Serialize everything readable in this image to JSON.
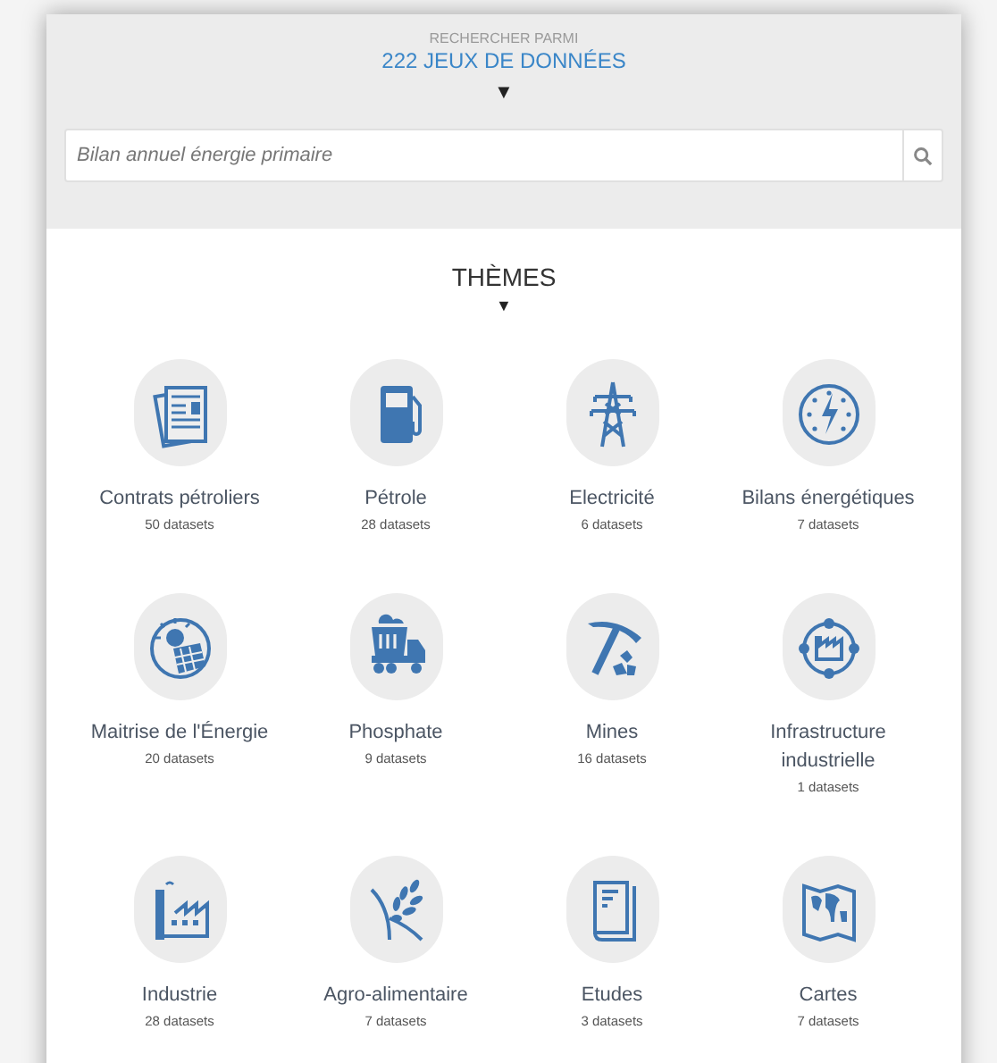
{
  "header": {
    "overline": "RECHERCHER PARMI",
    "title": "222 JEUX DE DONNÉES",
    "toggle": "▼"
  },
  "search": {
    "placeholder": "Bilan annuel énergie primaire"
  },
  "themes": {
    "title": "THÈMES",
    "toggle": "▼",
    "items": [
      {
        "kind": "contracts",
        "label": "Contrats pétroliers",
        "count": "50 datasets"
      },
      {
        "kind": "fuel",
        "label": "Pétrole",
        "count": "28 datasets"
      },
      {
        "kind": "pylon",
        "label": "Electricité",
        "count": "6 datasets"
      },
      {
        "kind": "gauge",
        "label": "Bilans énergétiques",
        "count": "7 datasets"
      },
      {
        "kind": "solar",
        "label": "Maitrise de l'Énergie",
        "count": "20 datasets"
      },
      {
        "kind": "truck",
        "label": "Phosphate",
        "count": "9 datasets"
      },
      {
        "kind": "pickaxe",
        "label": "Mines",
        "count": "16 datasets"
      },
      {
        "kind": "network",
        "label": "Infrastructure industrielle",
        "count": "1 datasets"
      },
      {
        "kind": "factory",
        "label": "Industrie",
        "count": "28 datasets"
      },
      {
        "kind": "wheat",
        "label": "Agro-alimentaire",
        "count": "7 datasets"
      },
      {
        "kind": "book",
        "label": "Etudes",
        "count": "3 datasets"
      },
      {
        "kind": "map",
        "label": "Cartes",
        "count": "7 datasets"
      }
    ]
  }
}
